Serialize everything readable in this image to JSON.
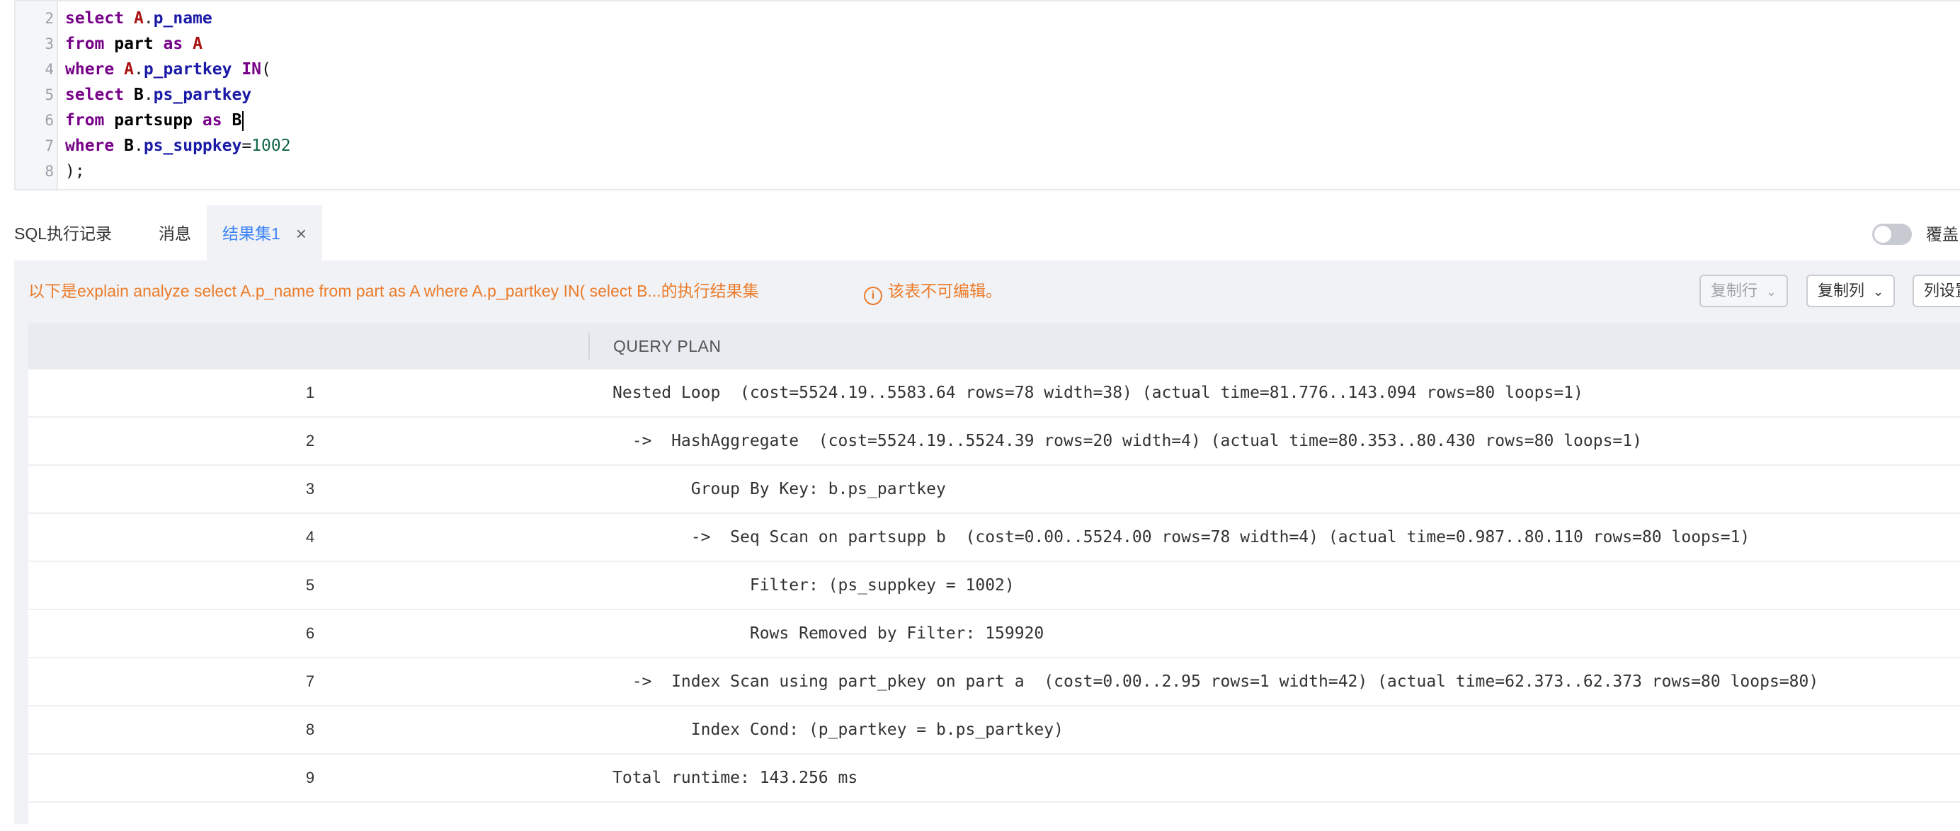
{
  "editor": {
    "lines": [
      {
        "num": "2",
        "tokens": [
          {
            "t": "select",
            "c": "kw"
          },
          {
            "t": " "
          },
          {
            "t": "A",
            "c": "al"
          },
          {
            "t": "."
          },
          {
            "t": "p_name",
            "c": "col"
          }
        ]
      },
      {
        "num": "3",
        "tokens": [
          {
            "t": "from",
            "c": "kw"
          },
          {
            "t": " "
          },
          {
            "t": "part",
            "c": "plain"
          },
          {
            "t": " "
          },
          {
            "t": "as",
            "c": "kw"
          },
          {
            "t": " "
          },
          {
            "t": "A",
            "c": "al"
          }
        ]
      },
      {
        "num": "4",
        "tokens": [
          {
            "t": "where",
            "c": "kw"
          },
          {
            "t": " "
          },
          {
            "t": "A",
            "c": "al"
          },
          {
            "t": "."
          },
          {
            "t": "p_partkey",
            "c": "col"
          },
          {
            "t": " "
          },
          {
            "t": "IN",
            "c": "kw"
          },
          {
            "t": "("
          }
        ]
      },
      {
        "num": "5",
        "tokens": [
          {
            "t": "select",
            "c": "kw"
          },
          {
            "t": " "
          },
          {
            "t": "B",
            "c": "plain"
          },
          {
            "t": "."
          },
          {
            "t": "ps_partkey",
            "c": "col"
          }
        ]
      },
      {
        "num": "6",
        "tokens": [
          {
            "t": "from",
            "c": "kw"
          },
          {
            "t": " "
          },
          {
            "t": "partsupp",
            "c": "plain"
          },
          {
            "t": " "
          },
          {
            "t": "as",
            "c": "kw"
          },
          {
            "t": " "
          },
          {
            "t": "B",
            "c": "plain"
          }
        ],
        "cursor": true
      },
      {
        "num": "7",
        "tokens": [
          {
            "t": "where",
            "c": "kw"
          },
          {
            "t": " "
          },
          {
            "t": "B",
            "c": "plain"
          },
          {
            "t": "."
          },
          {
            "t": "ps_suppkey",
            "c": "col"
          },
          {
            "t": "="
          },
          {
            "t": "1002",
            "c": "nm"
          }
        ]
      },
      {
        "num": "8",
        "tokens": [
          {
            "t": ");"
          }
        ]
      }
    ]
  },
  "tabs": {
    "history": "SQL执行记录",
    "messages": "消息",
    "result1": "结果集1",
    "close_icon": "×"
  },
  "toggle": {
    "label": "覆盖",
    "on": false
  },
  "result": {
    "notice": "以下是explain analyze select A.p_name from part as A where A.p_partkey IN( select B...的执行结果集",
    "readonly": "该表不可编辑。",
    "info_icon": "i",
    "buttons": {
      "copy_row": "复制行",
      "copy_col": "复制列",
      "col_settings": "列设置"
    },
    "header": "QUERY PLAN",
    "rows": [
      {
        "idx": "1",
        "plan": "Nested Loop  (cost=5524.19..5583.64 rows=78 width=38) (actual time=81.776..143.094 rows=80 loops=1)"
      },
      {
        "idx": "2",
        "plan": "  ->  HashAggregate  (cost=5524.19..5524.39 rows=20 width=4) (actual time=80.353..80.430 rows=80 loops=1)"
      },
      {
        "idx": "3",
        "plan": "        Group By Key: b.ps_partkey"
      },
      {
        "idx": "4",
        "plan": "        ->  Seq Scan on partsupp b  (cost=0.00..5524.00 rows=78 width=4) (actual time=0.987..80.110 rows=80 loops=1)"
      },
      {
        "idx": "5",
        "plan": "              Filter: (ps_suppkey = 1002)"
      },
      {
        "idx": "6",
        "plan": "              Rows Removed by Filter: 159920"
      },
      {
        "idx": "7",
        "plan": "  ->  Index Scan using part_pkey on part a  (cost=0.00..2.95 rows=1 width=42) (actual time=62.373..62.373 rows=80 loops=80)"
      },
      {
        "idx": "8",
        "plan": "        Index Cond: (p_partkey = b.ps_partkey)"
      },
      {
        "idx": "9",
        "plan": "Total runtime: 143.256 ms"
      }
    ]
  }
}
